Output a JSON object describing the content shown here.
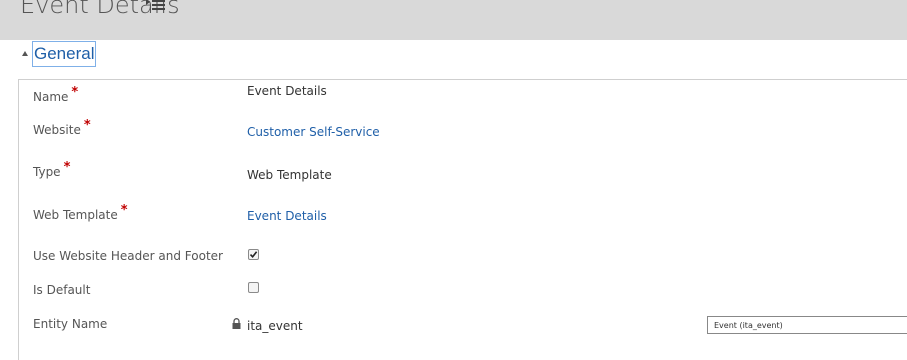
{
  "header": {
    "title": "Event Details",
    "menu_icon": "list-menu-icon"
  },
  "section": {
    "title": "General",
    "collapse_icon": "triangle-up-icon"
  },
  "fields": {
    "name": {
      "label": "Name",
      "required": "*",
      "value": "Event Details"
    },
    "website": {
      "label": "Website",
      "required": "*",
      "value": "Customer Self-Service"
    },
    "type": {
      "label": "Type",
      "required": "*",
      "value": "Web Template"
    },
    "web_template": {
      "label": "Web Template",
      "required": "*",
      "value": "Event Details"
    },
    "use_header_footer": {
      "label": "Use Website Header and Footer",
      "checked": true
    },
    "is_default": {
      "label": "Is Default",
      "checked": false
    },
    "entity_name": {
      "label": "Entity Name",
      "value": "ita_event",
      "lookup_value": "Event (ita_event)",
      "lock_icon": "lock-icon"
    }
  },
  "colors": {
    "link": "#1f5fa8",
    "required": "#c00000",
    "header_bg": "#d9d9d9"
  }
}
